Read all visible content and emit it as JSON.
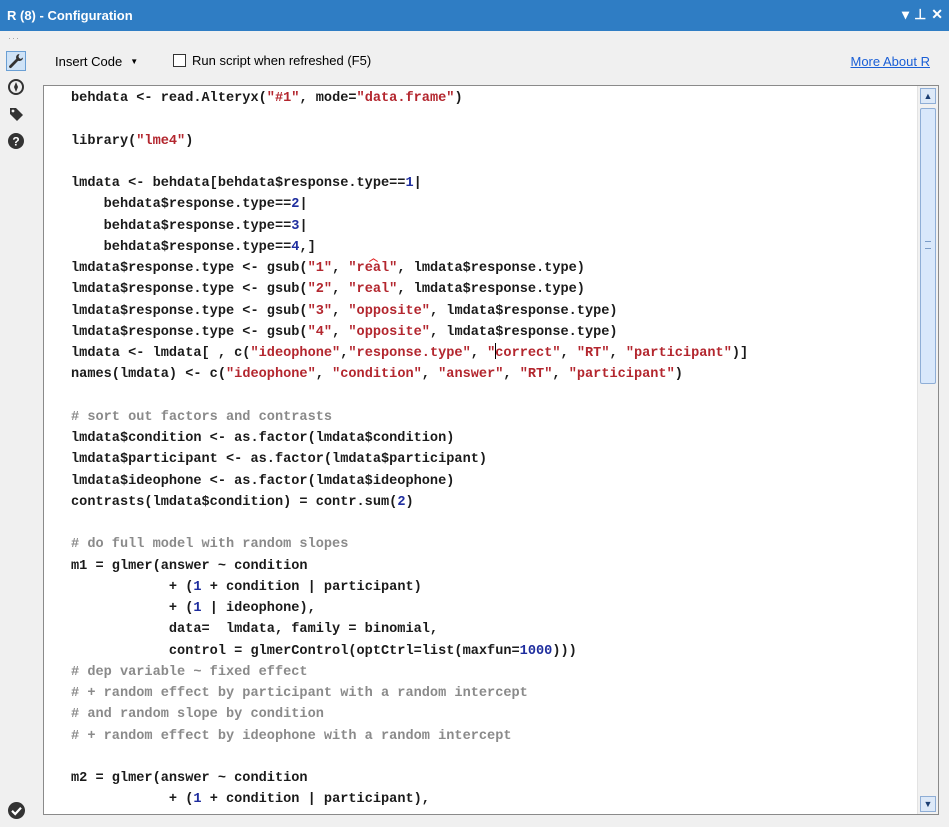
{
  "window": {
    "title": "R (8) - Configuration",
    "controls": {
      "dropdown": "▾",
      "pin": "⊥",
      "close": "✕"
    }
  },
  "left_toolbar": {
    "grip": "···",
    "tools": [
      {
        "name": "wrench-icon",
        "active": true
      },
      {
        "name": "compass-icon",
        "active": false
      },
      {
        "name": "tag-icon",
        "active": false
      },
      {
        "name": "help-icon",
        "active": false
      }
    ],
    "status_icon": "checkmark-circle-icon"
  },
  "toolbar": {
    "insert_code_label": "Insert Code",
    "run_script_label": "Run script when refreshed (F5)",
    "run_script_checked": false,
    "more_about_label": "More About R"
  },
  "colors": {
    "titlebar": "#2f7dc4",
    "string": "#b3262e",
    "number": "#1e2d9e",
    "comment": "#8a8a8a",
    "link": "#1a5fd6"
  },
  "editor": {
    "lines": [
      [
        [
          "p",
          "behdata <- read.Alteryx("
        ],
        [
          "s",
          "\"#1\""
        ],
        [
          "p",
          ", mode="
        ],
        [
          "s",
          "\"data.frame\""
        ],
        [
          "p",
          ")"
        ]
      ],
      [],
      [
        [
          "p",
          "library("
        ],
        [
          "s",
          "\"lme4\""
        ],
        [
          "p",
          ")"
        ]
      ],
      [],
      [
        [
          "p",
          "lmdata <- behdata[behdata$response.type=="
        ],
        [
          "n",
          "1"
        ],
        [
          "p",
          "|"
        ]
      ],
      [
        [
          "p",
          "    behdata$response.type=="
        ],
        [
          "n",
          "2"
        ],
        [
          "p",
          "|"
        ]
      ],
      [
        [
          "p",
          "    behdata$response.type=="
        ],
        [
          "n",
          "3"
        ],
        [
          "p",
          "|"
        ]
      ],
      [
        [
          "p",
          "    behdata$response.type=="
        ],
        [
          "n",
          "4"
        ],
        [
          "p",
          ",]"
        ]
      ],
      [
        [
          "p",
          "lmdata$response.type <- gsub("
        ],
        [
          "s",
          "\"1\""
        ],
        [
          "p",
          ", "
        ],
        [
          "s",
          "\"real\""
        ],
        [
          "p",
          ", lmdata$response.type)"
        ]
      ],
      [
        [
          "p",
          "lmdata$response.type <- gsub("
        ],
        [
          "s",
          "\"2\""
        ],
        [
          "p",
          ", "
        ],
        [
          "s",
          "\"real\""
        ],
        [
          "p",
          ", lmdata$response.type)"
        ]
      ],
      [
        [
          "p",
          "lmdata$response.type <- gsub("
        ],
        [
          "s",
          "\"3\""
        ],
        [
          "p",
          ", "
        ],
        [
          "s",
          "\"opposite\""
        ],
        [
          "p",
          ", lmdata$response.type)"
        ]
      ],
      [
        [
          "p",
          "lmdata$response.type <- gsub("
        ],
        [
          "s",
          "\"4\""
        ],
        [
          "p",
          ", "
        ],
        [
          "s",
          "\"opposite\""
        ],
        [
          "p",
          ", lmdata$response.type)"
        ]
      ],
      [
        [
          "p",
          "lmdata <- lmdata[ , c("
        ],
        [
          "s",
          "\"ideophone\""
        ],
        [
          "p",
          ","
        ],
        [
          "s",
          "\"response.type\""
        ],
        [
          "p",
          ", "
        ],
        [
          "s",
          "\""
        ],
        [
          "cur",
          ""
        ],
        [
          "s",
          "correct\""
        ],
        [
          "p",
          ", "
        ],
        [
          "s",
          "\"RT\""
        ],
        [
          "p",
          ", "
        ],
        [
          "s",
          "\"participant\""
        ],
        [
          "p",
          ")]"
        ]
      ],
      [
        [
          "p",
          "names(lmdata) <- c("
        ],
        [
          "s",
          "\"ideophone\""
        ],
        [
          "p",
          ", "
        ],
        [
          "s",
          "\"condition\""
        ],
        [
          "p",
          ", "
        ],
        [
          "s",
          "\"answer\""
        ],
        [
          "p",
          ", "
        ],
        [
          "s",
          "\"RT\""
        ],
        [
          "p",
          ", "
        ],
        [
          "s",
          "\"participant\""
        ],
        [
          "p",
          ")"
        ]
      ],
      [],
      [
        [
          "c",
          "# sort out factors and contrasts"
        ]
      ],
      [
        [
          "p",
          "lmdata$condition <- as.factor(lmdata$condition)"
        ]
      ],
      [
        [
          "p",
          "lmdata$participant <- as.factor(lmdata$participant)"
        ]
      ],
      [
        [
          "p",
          "lmdata$ideophone <- as.factor(lmdata$ideophone)"
        ]
      ],
      [
        [
          "p",
          "contrasts(lmdata$condition) = contr.sum("
        ],
        [
          "n",
          "2"
        ],
        [
          "p",
          ")"
        ]
      ],
      [],
      [
        [
          "c",
          "# do full model with random slopes"
        ]
      ],
      [
        [
          "p",
          "m1 = glmer(answer ~ condition"
        ]
      ],
      [
        [
          "p",
          "            + ("
        ],
        [
          "n",
          "1"
        ],
        [
          "p",
          " + condition | participant)"
        ]
      ],
      [
        [
          "p",
          "            + ("
        ],
        [
          "n",
          "1"
        ],
        [
          "p",
          " | ideophone),"
        ]
      ],
      [
        [
          "p",
          "            data=  lmdata, family = binomial,"
        ]
      ],
      [
        [
          "p",
          "            control = glmerControl(optCtrl=list(maxfun="
        ],
        [
          "n",
          "1000"
        ],
        [
          "p",
          ")))"
        ]
      ],
      [
        [
          "c",
          "# dep variable ~ fixed effect"
        ]
      ],
      [
        [
          "c",
          "# + random effect by participant with a random intercept"
        ]
      ],
      [
        [
          "c",
          "# and random slope by condition"
        ]
      ],
      [
        [
          "c",
          "# + random effect by ideophone with a random intercept"
        ]
      ],
      [],
      [
        [
          "p",
          "m2 = glmer(answer ~ condition"
        ]
      ],
      [
        [
          "p",
          "            + ("
        ],
        [
          "n",
          "1"
        ],
        [
          "p",
          " + condition | participant),"
        ]
      ]
    ]
  }
}
